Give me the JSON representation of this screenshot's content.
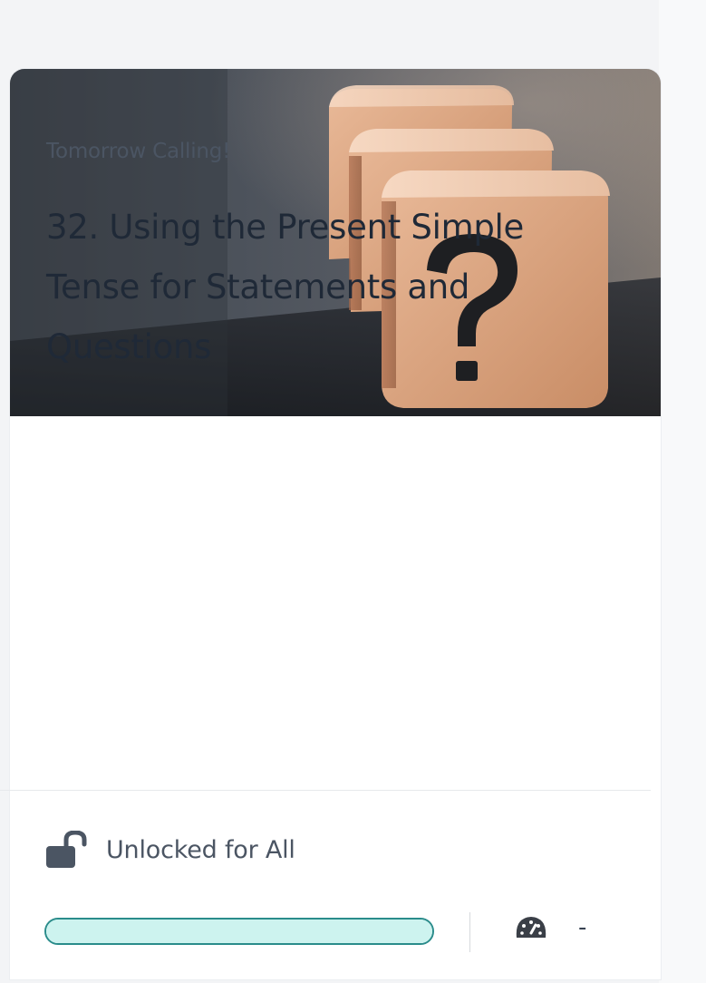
{
  "card": {
    "category": "Tomorrow Calling!",
    "title": "32. Using the Present Simple Tense for Statements and Questions",
    "access_label": "Unlocked for All",
    "progress_percent": 100,
    "score": "-",
    "image_icon": "question-mark-wooden-blocks",
    "lock_icon": "unlocked-padlock-icon",
    "gauge_icon": "speedometer-icon"
  },
  "colors": {
    "progress_border": "#2a8c8b",
    "progress_fill": "#cdf3ef",
    "icon": "#4b5563",
    "title_text": "#1f2937"
  }
}
